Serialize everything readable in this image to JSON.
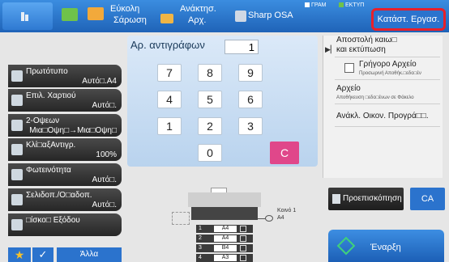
{
  "topbar": {
    "easy_scan": [
      "Εύκολη",
      "Σάρωση"
    ],
    "retrieve": [
      "Ανάκτησ.",
      "Αρχ."
    ],
    "osa": "Sharp OSA",
    "indicator_fax": "ΓΡΑΜ",
    "indicator_print": "ΕΚΤΥΠ",
    "job_status": "Κατάστ. Εργασ."
  },
  "left_menu": [
    {
      "label": "Πρωτότυπο",
      "value": "Αυτό□.A4"
    },
    {
      "label": "Επιλ. Χαρτιού",
      "value": "Αυτό□."
    },
    {
      "label": "2-Οψεων",
      "value": "Μια□Οψη□→Μια□Οψη□"
    },
    {
      "label": "Κλί□αξΑντιγρ.",
      "value": "100%"
    },
    {
      "label": "Φωτεινότητα",
      "value": "Αυτό□."
    },
    {
      "label": "Σελιδοπ./Ο□αδοπ.",
      "value": "Αυτό□."
    },
    {
      "label": "□ίσκο□ Εξόδου",
      "value": ""
    }
  ],
  "bottom_left": {
    "others": "Άλλα",
    "favorite_icon": "star",
    "check_icon": "check"
  },
  "copy_panel": {
    "label": "Αρ. αντιγράφων",
    "count": "1",
    "keys": [
      "7",
      "8",
      "9",
      "4",
      "5",
      "6",
      "1",
      "2",
      "3",
      "0"
    ],
    "clear": "C"
  },
  "right_panel": {
    "send_print": [
      "Αποστολή καιω□",
      "και εκτύπωση"
    ],
    "quick_file": "Γρήγορο Αρχείο",
    "quick_file_sub": "Προσωρινή Αποθήκ.□εδο□έν",
    "file": "Αρχείο",
    "file_sub": "Αποθήκευση □εδο□ένων σε Φάκελο",
    "eco": "Ανάκλ. Οικον. Προγρά□□."
  },
  "actions": {
    "preview": "Προεπισκόπηση",
    "ca": "CA",
    "start": "Έναρξη"
  },
  "trays": [
    {
      "n": "1",
      "size": "A4"
    },
    {
      "n": "2",
      "size": "A4"
    },
    {
      "n": "3",
      "size": "B4"
    },
    {
      "n": "4",
      "size": "A3"
    }
  ],
  "bypass": [
    "Κοινό 1",
    "A4"
  ],
  "colors": {
    "accent": "#2b73cd",
    "clear": "#e0478a",
    "highlight": "#e8202a"
  }
}
